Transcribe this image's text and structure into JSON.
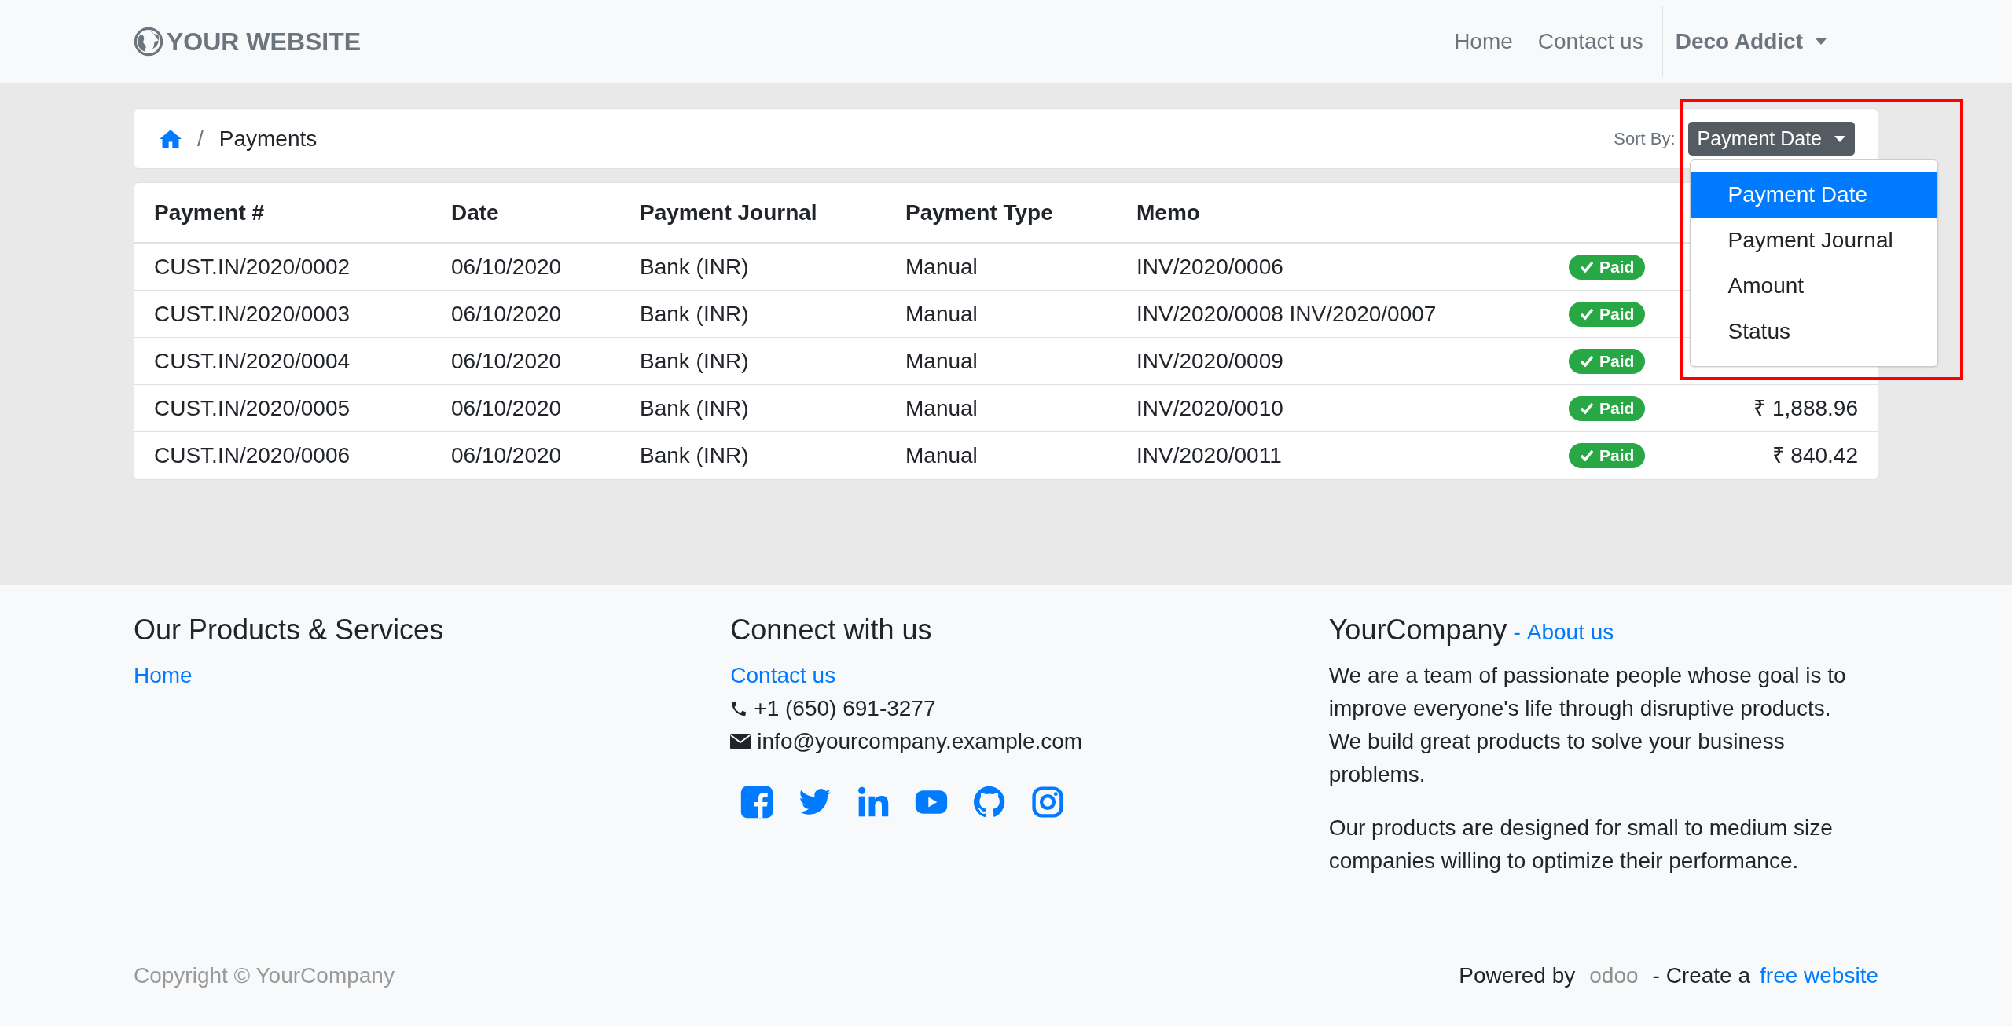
{
  "header": {
    "logo_text": "YOUR WEBSITE",
    "nav": [
      "Home",
      "Contact us"
    ],
    "user_menu": "Deco Addict"
  },
  "breadcrumb": {
    "separator": "/",
    "current": "Payments"
  },
  "sort": {
    "label": "Sort By:",
    "button": "Payment Date",
    "expanded": true,
    "options": [
      {
        "label": "Payment Date",
        "selected": true
      },
      {
        "label": "Payment Journal",
        "selected": false
      },
      {
        "label": "Amount",
        "selected": false
      },
      {
        "label": "Status",
        "selected": false
      }
    ]
  },
  "table": {
    "columns": [
      "Payment #",
      "Date",
      "Payment Journal",
      "Payment Type",
      "Memo"
    ],
    "rows": [
      {
        "cells": [
          "CUST.IN/2020/0002",
          "06/10/2020",
          "Bank (INR)",
          "Manual",
          "INV/2020/0006"
        ],
        "status": "Paid"
      },
      {
        "cells": [
          "CUST.IN/2020/0003",
          "06/10/2020",
          "Bank (INR)",
          "Manual",
          "INV/2020/0008 INV/2020/0007"
        ],
        "status": "Paid"
      },
      {
        "cells": [
          "CUST.IN/2020/0004",
          "06/10/2020",
          "Bank (INR)",
          "Manual",
          "INV/2020/0009"
        ],
        "status": "Paid"
      },
      {
        "cells": [
          "CUST.IN/2020/0005",
          "06/10/2020",
          "Bank (INR)",
          "Manual",
          "INV/2020/0010"
        ],
        "status": "Paid",
        "amount": "₹ 1,888.96"
      },
      {
        "cells": [
          "CUST.IN/2020/0006",
          "06/10/2020",
          "Bank (INR)",
          "Manual",
          "INV/2020/0011"
        ],
        "status": "Paid",
        "amount": "₹ 840.42"
      }
    ]
  },
  "footer": {
    "products": {
      "title": "Our Products & Services",
      "links": [
        "Home"
      ]
    },
    "connect": {
      "title": "Connect with us",
      "link": "Contact us",
      "phone": "+1 (650) 691-3277",
      "email": "info@yourcompany.example.com"
    },
    "company": {
      "title": "YourCompany",
      "separator": "-",
      "link": "About us",
      "paragraphs": [
        "We are a team of passionate people whose goal is to improve everyone's life through disruptive products. We build great products to solve your business problems.",
        "Our products are designed for small to medium size companies willing to optimize their performance."
      ]
    },
    "copyright": "Copyright © YourCompany",
    "powered_by": "Powered by",
    "odoo": "odoo",
    "create": "- Create a",
    "create_link": "free website"
  }
}
